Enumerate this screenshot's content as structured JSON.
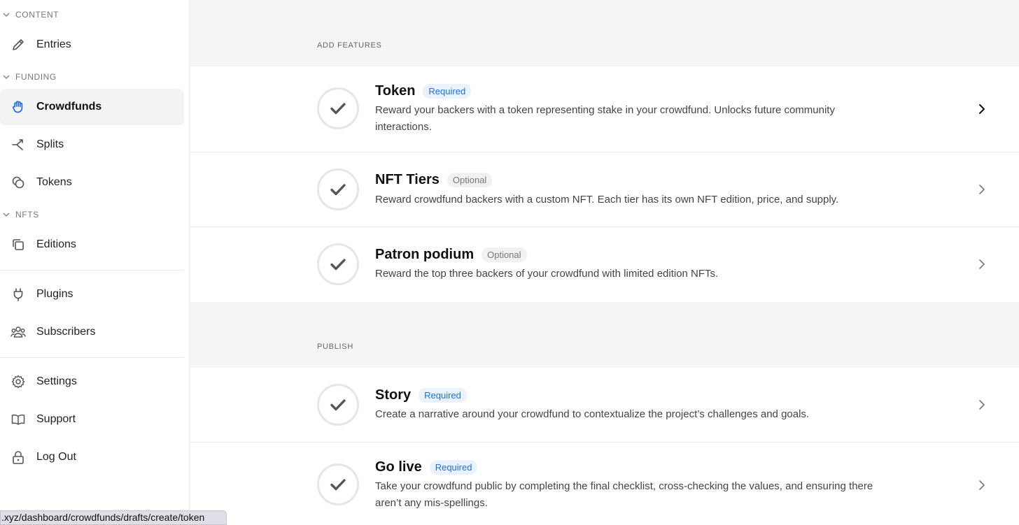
{
  "sidebar": {
    "sections": [
      {
        "label": "CONTENT"
      },
      {
        "label": "FUNDING"
      },
      {
        "label": "NFTS"
      }
    ],
    "items": [
      {
        "label": "Entries",
        "icon": "pencil-icon"
      },
      {
        "label": "Crowdfunds",
        "icon": "hand-icon",
        "active": true
      },
      {
        "label": "Splits",
        "icon": "split-arrows-icon"
      },
      {
        "label": "Tokens",
        "icon": "coins-icon"
      },
      {
        "label": "Editions",
        "icon": "copy-icon"
      },
      {
        "label": "Plugins",
        "icon": "plug-icon"
      },
      {
        "label": "Subscribers",
        "icon": "users-icon"
      },
      {
        "label": "Settings",
        "icon": "gear-icon"
      },
      {
        "label": "Support",
        "icon": "book-icon"
      },
      {
        "label": "Log Out",
        "icon": "lock-icon"
      }
    ]
  },
  "main": {
    "groups": [
      {
        "label": "ADD FEATURES",
        "rows": [
          {
            "title": "Token",
            "badge": "Required",
            "description": "Reward your backers with a token representing stake in your crowdfund. Unlocks future community interactions."
          },
          {
            "title": "NFT Tiers",
            "badge": "Optional",
            "description": "Reward crowdfund backers with a custom NFT. Each tier has its own NFT edition, price, and supply."
          },
          {
            "title": "Patron podium",
            "badge": "Optional",
            "description": "Reward the top three backers of your crowdfund with limited edition NFTs."
          }
        ]
      },
      {
        "label": "PUBLISH",
        "rows": [
          {
            "title": "Story",
            "badge": "Required",
            "description": "Create a narrative around your crowdfund to contextualize the project’s challenges and goals."
          },
          {
            "title": "Go live",
            "badge": "Required",
            "description": "Take your crowdfund public by completing the final checklist, cross-checking the values, and ensuring there aren’t any mis-spellings."
          }
        ]
      }
    ]
  },
  "status_url": ".xyz/dashboard/crowdfunds/drafts/create/token",
  "colors": {
    "accent": "#1f6fe0",
    "badge_required_bg": "#eaf2fd",
    "active_nav_bg": "#f3f3f3"
  }
}
